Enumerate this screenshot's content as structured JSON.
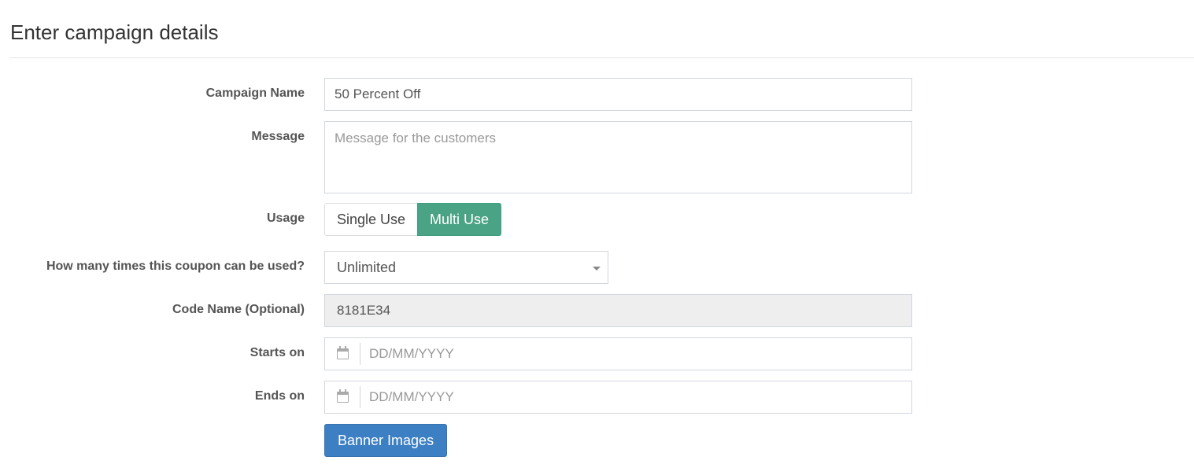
{
  "page": {
    "title": "Enter campaign details"
  },
  "form": {
    "campaign_name": {
      "label": "Campaign Name",
      "value": "50 Percent Off"
    },
    "message": {
      "label": "Message",
      "value": "",
      "placeholder": "Message for the customers"
    },
    "usage": {
      "label": "Usage",
      "options": [
        "Single Use",
        "Multi Use"
      ],
      "selected": "Multi Use",
      "active_color": "#4aa384"
    },
    "coupon_uses": {
      "label": "How many times this coupon can be used?",
      "selected": "Unlimited"
    },
    "code_name": {
      "label": "Code Name (Optional)",
      "value": "8181E34"
    },
    "starts_on": {
      "label": "Starts on",
      "icon": "calendar-icon",
      "placeholder": "DD/MM/YYYY"
    },
    "ends_on": {
      "label": "Ends on",
      "icon": "calendar-icon",
      "placeholder": "DD/MM/YYYY"
    },
    "banner_button": {
      "label": "Banner Images",
      "color": "#3c7fc3"
    }
  }
}
